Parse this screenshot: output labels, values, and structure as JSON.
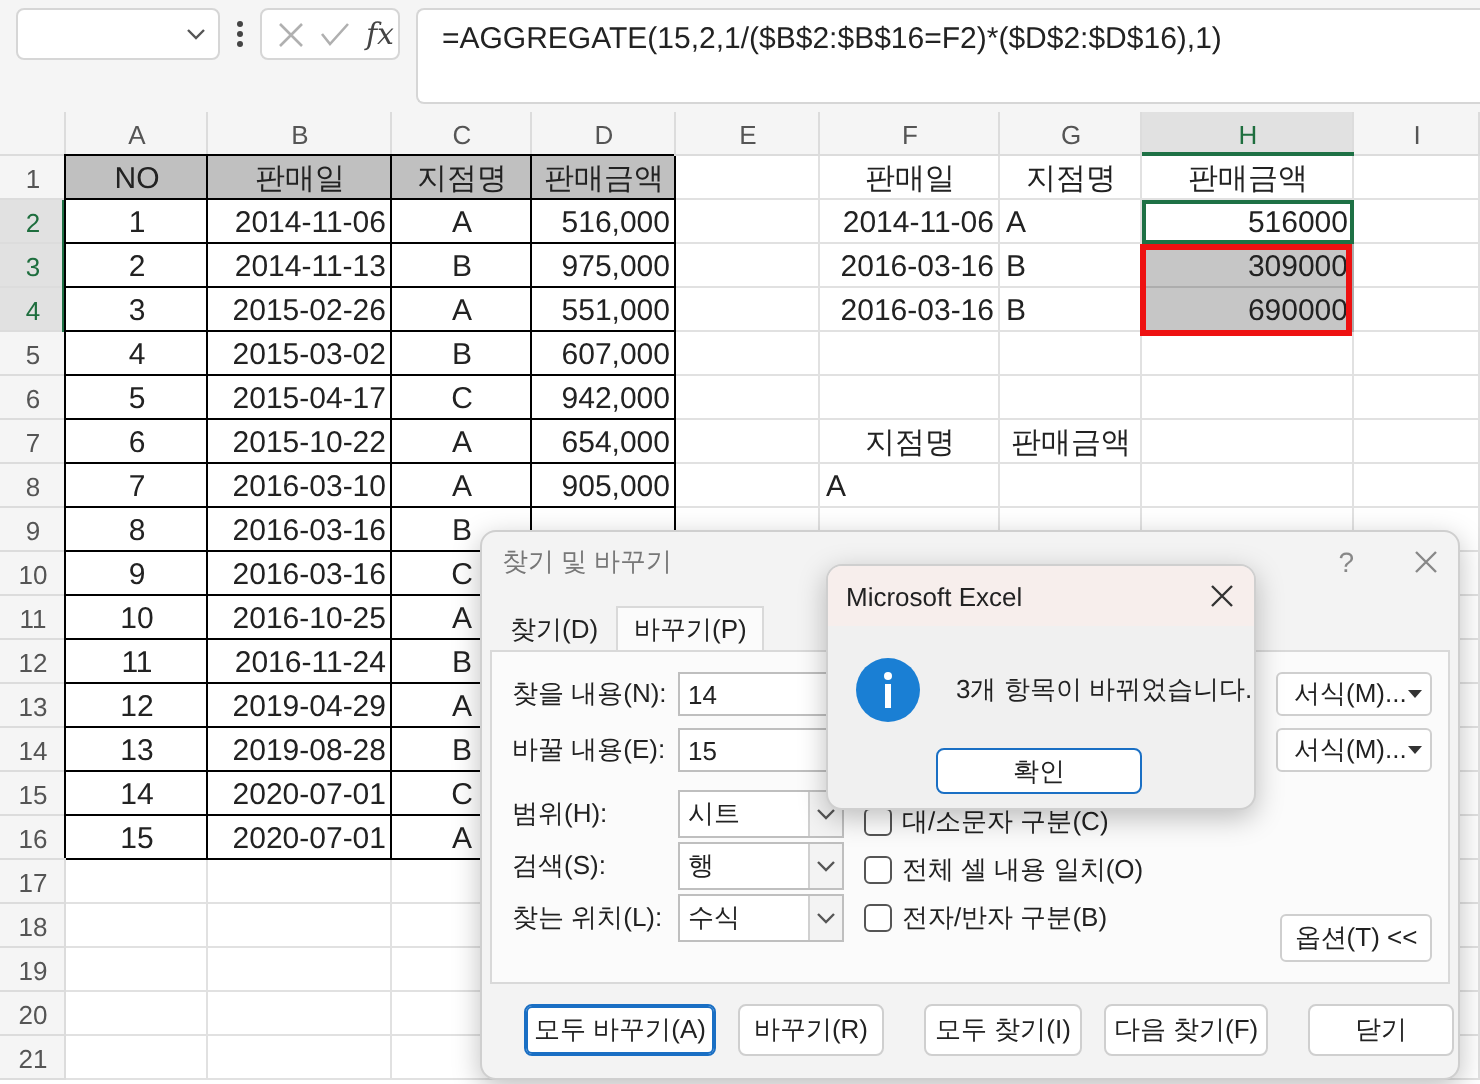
{
  "formula_bar": {
    "function_label": "fx",
    "formula": "=AGGREGATE(15,2,1/($B$2:$B$16=F2)*($D$2:$D$16),1)"
  },
  "columns": [
    {
      "label": "A",
      "selected": false
    },
    {
      "label": "B",
      "selected": false
    },
    {
      "label": "C",
      "selected": false
    },
    {
      "label": "D",
      "selected": false
    },
    {
      "label": "E",
      "selected": false
    },
    {
      "label": "F",
      "selected": false
    },
    {
      "label": "G",
      "selected": false
    },
    {
      "label": "H",
      "selected": true
    },
    {
      "label": "I",
      "selected": false
    }
  ],
  "rows": [
    {
      "label": "1",
      "selected": false,
      "cells": [
        {
          "kind": "header",
          "text": "NO"
        },
        {
          "kind": "header",
          "text": "판매일"
        },
        {
          "kind": "header",
          "text": "지점명"
        },
        {
          "kind": "header",
          "text": "판매금액"
        },
        {
          "kind": "blank"
        },
        {
          "kind": "center",
          "text": "판매일"
        },
        {
          "kind": "center",
          "text": "지점명"
        },
        {
          "kind": "center",
          "text": "판매금액"
        },
        {
          "kind": "blank"
        }
      ]
    },
    {
      "label": "2",
      "selected": true,
      "cells": [
        {
          "kind": "box-center",
          "text": "1"
        },
        {
          "kind": "box-right",
          "text": "2014-11-06"
        },
        {
          "kind": "box-center",
          "text": "A"
        },
        {
          "kind": "box-right",
          "text": "516,000"
        },
        {
          "kind": "blank"
        },
        {
          "kind": "right",
          "text": "2014-11-06"
        },
        {
          "kind": "left",
          "text": "A"
        },
        {
          "kind": "right",
          "text": "516000",
          "active": true
        },
        {
          "kind": "blank"
        }
      ]
    },
    {
      "label": "3",
      "selected": true,
      "cells": [
        {
          "kind": "box-center",
          "text": "2"
        },
        {
          "kind": "box-right",
          "text": "2014-11-13"
        },
        {
          "kind": "box-center",
          "text": "B"
        },
        {
          "kind": "box-right",
          "text": "975,000"
        },
        {
          "kind": "blank"
        },
        {
          "kind": "right",
          "text": "2016-03-16"
        },
        {
          "kind": "left",
          "text": "B"
        },
        {
          "kind": "right",
          "text": "309000",
          "selected": true
        },
        {
          "kind": "blank"
        }
      ]
    },
    {
      "label": "4",
      "selected": true,
      "cells": [
        {
          "kind": "box-center",
          "text": "3"
        },
        {
          "kind": "box-right",
          "text": "2015-02-26"
        },
        {
          "kind": "box-center",
          "text": "A"
        },
        {
          "kind": "box-right",
          "text": "551,000"
        },
        {
          "kind": "blank"
        },
        {
          "kind": "right",
          "text": "2016-03-16"
        },
        {
          "kind": "left",
          "text": "B"
        },
        {
          "kind": "right",
          "text": "690000",
          "selected": true
        },
        {
          "kind": "blank"
        }
      ]
    },
    {
      "label": "5",
      "selected": false,
      "cells": [
        {
          "kind": "box-center",
          "text": "4"
        },
        {
          "kind": "box-right",
          "text": "2015-03-02"
        },
        {
          "kind": "box-center",
          "text": "B"
        },
        {
          "kind": "box-right",
          "text": "607,000"
        }
      ]
    },
    {
      "label": "6",
      "selected": false,
      "cells": [
        {
          "kind": "box-center",
          "text": "5"
        },
        {
          "kind": "box-right",
          "text": "2015-04-17"
        },
        {
          "kind": "box-center",
          "text": "C"
        },
        {
          "kind": "box-right",
          "text": "942,000"
        }
      ]
    },
    {
      "label": "7",
      "selected": false,
      "cells": [
        {
          "kind": "box-center",
          "text": "6"
        },
        {
          "kind": "box-right",
          "text": "2015-10-22"
        },
        {
          "kind": "box-center",
          "text": "A"
        },
        {
          "kind": "box-right",
          "text": "654,000"
        },
        {
          "kind": "blank"
        },
        {
          "kind": "center",
          "text": "지점명"
        },
        {
          "kind": "center",
          "text": "판매금액"
        }
      ]
    },
    {
      "label": "8",
      "selected": false,
      "cells": [
        {
          "kind": "box-center",
          "text": "7"
        },
        {
          "kind": "box-right",
          "text": "2016-03-10"
        },
        {
          "kind": "box-center",
          "text": "A"
        },
        {
          "kind": "box-right",
          "text": "905,000"
        },
        {
          "kind": "blank"
        },
        {
          "kind": "left",
          "text": "A"
        }
      ]
    },
    {
      "label": "9",
      "selected": false,
      "cells": [
        {
          "kind": "box-center",
          "text": "8"
        },
        {
          "kind": "box-right",
          "text": "2016-03-16"
        },
        {
          "kind": "box-center",
          "text": "B"
        },
        {
          "kind": "box-right"
        }
      ]
    },
    {
      "label": "10",
      "selected": false,
      "cells": [
        {
          "kind": "box-center",
          "text": "9"
        },
        {
          "kind": "box-right",
          "text": "2016-03-16"
        },
        {
          "kind": "box-center",
          "text": "C"
        },
        {
          "kind": "box-right"
        }
      ]
    },
    {
      "label": "11",
      "selected": false,
      "cells": [
        {
          "kind": "box-center",
          "text": "10"
        },
        {
          "kind": "box-right",
          "text": "2016-10-25"
        },
        {
          "kind": "box-center",
          "text": "A"
        },
        {
          "kind": "box-right"
        }
      ]
    },
    {
      "label": "12",
      "selected": false,
      "cells": [
        {
          "kind": "box-center",
          "text": "11"
        },
        {
          "kind": "box-right",
          "text": "2016-11-24"
        },
        {
          "kind": "box-center",
          "text": "B"
        },
        {
          "kind": "box-right"
        }
      ]
    },
    {
      "label": "13",
      "selected": false,
      "cells": [
        {
          "kind": "box-center",
          "text": "12"
        },
        {
          "kind": "box-right",
          "text": "2019-04-29"
        },
        {
          "kind": "box-center",
          "text": "A"
        },
        {
          "kind": "box-right"
        }
      ]
    },
    {
      "label": "14",
      "selected": false,
      "cells": [
        {
          "kind": "box-center",
          "text": "13"
        },
        {
          "kind": "box-right",
          "text": "2019-08-28"
        },
        {
          "kind": "box-center",
          "text": "B"
        },
        {
          "kind": "box-right"
        }
      ]
    },
    {
      "label": "15",
      "selected": false,
      "cells": [
        {
          "kind": "box-center",
          "text": "14"
        },
        {
          "kind": "box-right",
          "text": "2020-07-01"
        },
        {
          "kind": "box-center",
          "text": "C"
        },
        {
          "kind": "box-right"
        }
      ]
    },
    {
      "label": "16",
      "selected": false,
      "cells": [
        {
          "kind": "box-center",
          "text": "15"
        },
        {
          "kind": "box-right",
          "text": "2020-07-01"
        },
        {
          "kind": "box-center",
          "text": "A"
        },
        {
          "kind": "box-right"
        }
      ]
    },
    {
      "label": "17",
      "selected": false,
      "cells": []
    },
    {
      "label": "18",
      "selected": false,
      "cells": []
    },
    {
      "label": "19",
      "selected": false,
      "cells": []
    },
    {
      "label": "20",
      "selected": false,
      "cells": []
    },
    {
      "label": "21",
      "selected": false,
      "cells": []
    }
  ],
  "find_dialog": {
    "title": "찾기 및 바꾸기",
    "help": "?",
    "tabs": [
      {
        "label": "찾기(D)",
        "selected": false
      },
      {
        "label": "바꾸기(P)",
        "selected": true
      }
    ],
    "fields": [
      {
        "label": "찾을 내용(N):",
        "value": "14",
        "format_button": "서식(M)..."
      },
      {
        "label": "바꿀 내용(E):",
        "value": "15",
        "format_button": "서식(M)..."
      }
    ],
    "dropdowns": [
      {
        "label": "범위(H):",
        "value": "시트"
      },
      {
        "label": "검색(S):",
        "value": "행"
      },
      {
        "label": "찾는 위치(L):",
        "value": "수식"
      }
    ],
    "checkboxes": [
      {
        "label": "대/소문자 구분(C)",
        "checked": false
      },
      {
        "label": "전체 셀 내용 일치(O)",
        "checked": false
      },
      {
        "label": "전자/반자 구분(B)",
        "checked": false
      }
    ],
    "options_button": "옵션(T) <<",
    "buttons": [
      {
        "label": "모두 바꾸기(A)",
        "default": true
      },
      {
        "label": "바꾸기(R)",
        "default": false
      },
      {
        "label": "모두 찾기(I)",
        "default": false
      },
      {
        "label": "다음 찾기(F)",
        "default": false
      },
      {
        "label": "닫기",
        "default": false
      }
    ]
  },
  "message_box": {
    "title": "Microsoft Excel",
    "message": "3개 항목이 바뀌었습니다.",
    "button": "확인"
  }
}
